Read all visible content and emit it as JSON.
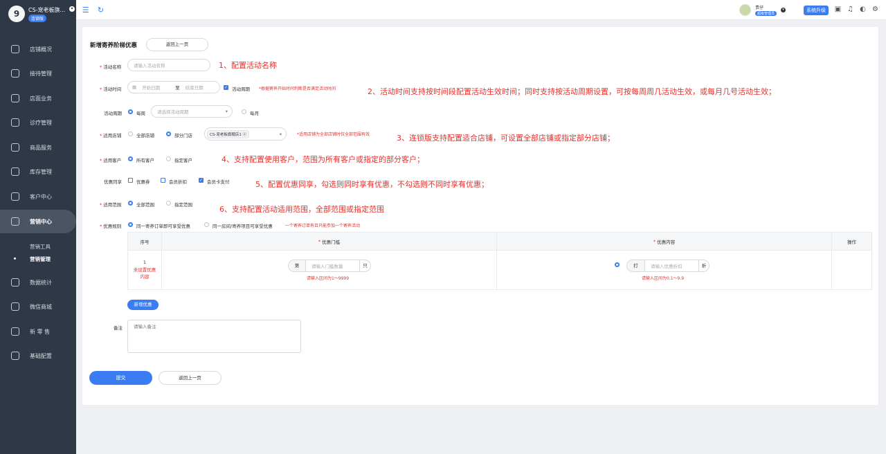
{
  "sidebar": {
    "logo_text": "9",
    "store_name": "CS-宠老板旗...",
    "edition": "连锁版",
    "items": [
      {
        "label": "店铺概况",
        "icon": "store-icon"
      },
      {
        "label": "接待管理",
        "icon": "reception-icon"
      },
      {
        "label": "店面业务",
        "icon": "shop-icon"
      },
      {
        "label": "诊疗管理",
        "icon": "medical-icon"
      },
      {
        "label": "商品服务",
        "icon": "goods-icon"
      },
      {
        "label": "库存管理",
        "icon": "inventory-icon"
      },
      {
        "label": "客户中心",
        "icon": "customer-icon"
      },
      {
        "label": "营销中心",
        "icon": "marketing-icon"
      },
      {
        "label": "数据统计",
        "icon": "stats-icon"
      },
      {
        "label": "微信商城",
        "icon": "wechat-icon"
      },
      {
        "label": "新 零 售",
        "icon": "retail-icon"
      },
      {
        "label": "基础配置",
        "icon": "settings-icon"
      }
    ],
    "sub_items": [
      "营销工具",
      "营销管理"
    ]
  },
  "topbar": {
    "user_name": "贵仔",
    "user_role": "超级管理员",
    "upgrade": "系统升级"
  },
  "form": {
    "title": "新增寄养阶梯优惠",
    "back_top": "返回上一页",
    "name_label": "活动名称",
    "name_placeholder": "请输入活动名称",
    "time_label": "活动时间",
    "start_placeholder": "开始日期",
    "to": "至",
    "end_placeholder": "结束日期",
    "cycle_check": "活动周期",
    "time_hint": "*根据寄养开始时间判断是否满足活动时间",
    "period_label": "活动周期",
    "weekly": "每周",
    "period_placeholder": "请选择活动周期",
    "monthly": "每月",
    "store_label": "适用店铺",
    "all_stores": "全部店铺",
    "some_stores": "部分门店",
    "store_tag": "CS-宠老板旗舰店1",
    "store_hint": "*适用店铺为全部店铺时仅全部范围有效",
    "customer_label": "适用客户",
    "all_customers": "所有客户",
    "some_customers": "指定客户",
    "share_label": "优惠同享",
    "share_coupon": "优惠券",
    "share_member": "会员折扣",
    "share_card": "会员卡支付",
    "scope_label": "适用范围",
    "all_scope": "全部范围",
    "some_scope": "指定范围",
    "rule_label": "优惠规则",
    "rule_a": "同一寄养订单即可享受优惠",
    "rule_b": "同一房间/寄养项目可享受优惠",
    "rule_hint": "一个寄养订单有且只能参加一个寄养活动",
    "add_button": "新增优惠",
    "remark_label": "备注",
    "remark_placeholder": "请输入备注",
    "submit": "提交",
    "back_bottom": "返回上一页"
  },
  "table": {
    "headers": [
      "序号",
      "优惠门槛",
      "优惠内容",
      "操作"
    ],
    "row": {
      "index": "1",
      "status": "未设置优惠内容",
      "pre": "第",
      "threshold_placeholder": "请输入门槛数量",
      "unit": "只",
      "threshold_hint": "请输入区间为1～9999",
      "discount_pre": "打",
      "discount_placeholder": "请输入优惠折扣",
      "discount_unit": "折",
      "discount_hint": "请输入区间为0.1～9.9"
    }
  },
  "notes": [
    "1、配置活动名称",
    "2、活动时间支持按时间段配置活动生效时间；同时支持按活动周期设置，可按每周周几活动生效，或每月几号活动生效；",
    "3、连锁版支持配置适合店铺，可设置全部店铺或指定部分店铺；",
    "4、支持配置使用客户，范围为所有客户或指定的部分客户；",
    "5、配置优惠同享，勾选则同时享有优惠，不勾选则不同时享有优惠；",
    "6、支持配置活动适用范围，全部范围或指定范围"
  ]
}
